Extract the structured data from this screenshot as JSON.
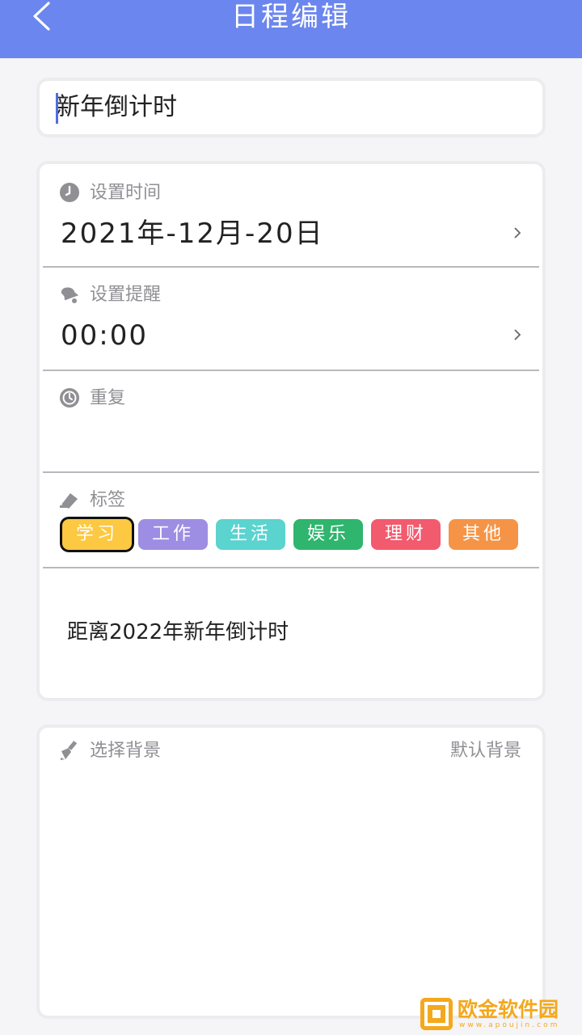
{
  "header": {
    "title": "日程编辑",
    "back_icon": "chevron-left-icon"
  },
  "event": {
    "title_value": "新年倒计时"
  },
  "date_section": {
    "label": "设置时间",
    "value": "2021年-12月-20日",
    "icon": "clock-icon"
  },
  "reminder_section": {
    "label": "设置提醒",
    "value": "00:00",
    "icon": "bell-icon"
  },
  "repeat_section": {
    "label": "重复",
    "icon": "repeat-clock-icon"
  },
  "tag_section": {
    "label": "标签",
    "icon": "tag-icon",
    "selected": "学习",
    "tags": [
      {
        "label": "学习",
        "color": "#fdc842"
      },
      {
        "label": "工作",
        "color": "#9d8ee3"
      },
      {
        "label": "生活",
        "color": "#5bd3cf"
      },
      {
        "label": "娱乐",
        "color": "#2fb56d"
      },
      {
        "label": "理财",
        "color": "#f25a6e"
      },
      {
        "label": "其他",
        "color": "#f59446"
      }
    ]
  },
  "note": {
    "value": "距离2022年新年倒计时"
  },
  "background_section": {
    "label": "选择背景",
    "value": "默认背景",
    "icon": "brush-icon"
  },
  "watermark": {
    "text": "欧金软件园",
    "url": "www.apoujin.com"
  },
  "colors": {
    "header": "#6b86ee",
    "accent_caret": "#4f6ee0"
  }
}
